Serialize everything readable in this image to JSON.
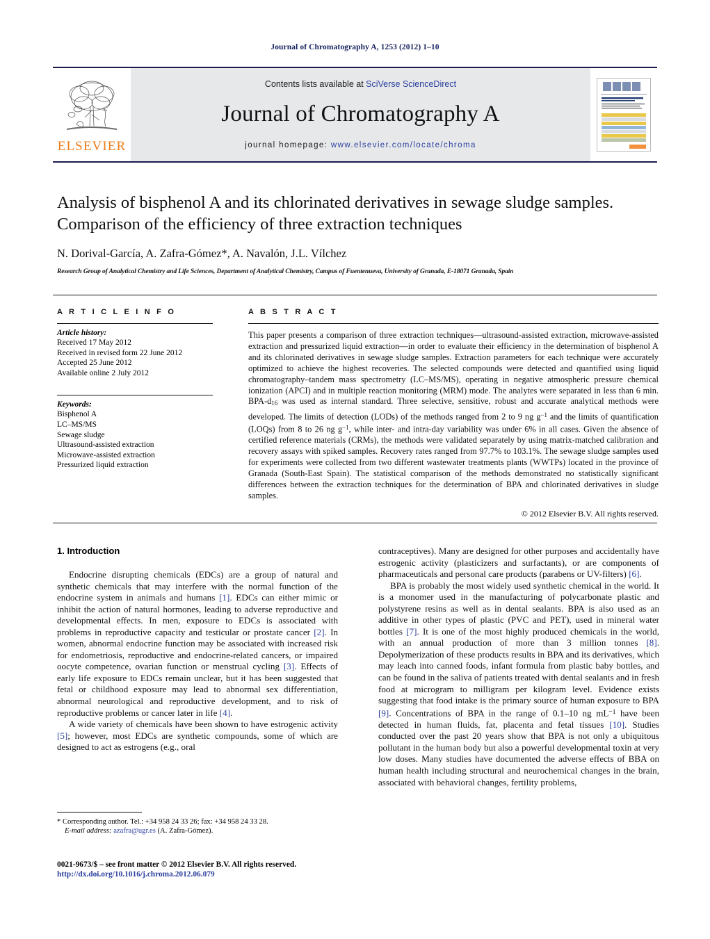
{
  "running_head": "Journal of Chromatography A, 1253 (2012) 1–10",
  "masthead": {
    "contents_prefix": "Contents lists available at ",
    "sciencedirect": "SciVerse ScienceDirect",
    "journal_name": "Journal of Chromatography A",
    "homepage_prefix": "journal homepage: ",
    "homepage_url": "www.elsevier.com/locate/chroma",
    "publisher_logo_text": "ELSEVIER",
    "publisher_logo_icon": "elsevier-tree-icon",
    "cover_thumbnail_icon": "journal-cover-thumbnail",
    "accent_link_color": "#2a3f9d",
    "logo_color": "#f07c1a",
    "rule_color": "#1a1a4e"
  },
  "article": {
    "title": "Analysis of bisphenol A and its chlorinated derivatives in sewage sludge samples. Comparison of the efficiency of three extraction techniques",
    "authors": "N. Dorival-García, A. Zafra-Gómez*, A. Navalón, J.L. Vílchez",
    "affiliation": "Research Group of Analytical Chemistry and Life Sciences, Department of Analytical Chemistry, Campus of Fuentenueva, University of Granada, E-18071 Granada, Spain"
  },
  "article_info": {
    "heading": "A R T I C L E   I N F O",
    "history_label": "Article history:",
    "history": [
      "Received 17 May 2012",
      "Received in revised form 22 June 2012",
      "Accepted 25 June 2012",
      "Available online 2 July 2012"
    ],
    "keywords_label": "Keywords:",
    "keywords": [
      "Bisphenol A",
      "LC–MS/MS",
      "Sewage sludge",
      "Ultrasound-assisted extraction",
      "Microwave-assisted extraction",
      "Pressurized liquid extraction"
    ]
  },
  "abstract": {
    "heading": "A B S T R A C T",
    "part1": "This paper presents a comparison of three extraction techniques—ultrasound-assisted extraction, microwave-assisted extraction and pressurized liquid extraction—in order to evaluate their efficiency in the determination of bisphenol A and its chlorinated derivatives in sewage sludge samples. Extraction parameters for each technique were accurately optimized to achieve the highest recoveries. The selected compounds were detected and quantified using liquid chromatography–tandem mass spectrometry (LC–MS/MS), operating in negative atmospheric pressure chemical ionization (APCI) and in multiple reaction monitoring (MRM) mode. The analytes were separated in less than 6 min. BPA-d",
    "sub1": "16",
    "part2": " was used as internal standard. Three selective, sensitive, robust and accurate analytical methods were developed. The limits of detection (LODs) of the methods ranged from 2 to 9 ng g",
    "sup1": "−1",
    "part3": " and the limits of quantification (LOQs) from 8 to 26 ng g",
    "sup2": "−1",
    "part4": ", while inter- and intra-day variability was under 6% in all cases. Given the absence of certified reference materials (CRMs), the methods were validated separately by using matrix-matched calibration and recovery assays with spiked samples. Recovery rates ranged from 97.7% to 103.1%. The sewage sludge samples used for experiments were collected from two different wastewater treatments plants (WWTPs) located in the province of Granada (South-East Spain). The statistical comparison of the methods demonstrated no statistically significant differences between the extraction techniques for the determination of BPA and chlorinated derivatives in sludge samples.",
    "copyright": "© 2012 Elsevier B.V. All rights reserved."
  },
  "introduction": {
    "heading": "1.  Introduction",
    "left": {
      "p1_a": "Endocrine disrupting chemicals (EDCs) are a group of natural and synthetic chemicals that may interfere with the normal function of the endocrine system in animals and humans ",
      "p1_ref1": "[1]",
      "p1_b": ". EDCs can either mimic or inhibit the action of natural hormones, leading to adverse reproductive and developmental effects. In men, exposure to EDCs is associated with problems in reproductive capacity and testicular or prostate cancer ",
      "p1_ref2": "[2]",
      "p1_c": ". In women, abnormal endocrine function may be associated with increased risk for endometriosis, reproductive and endocrine-related cancers, or impaired oocyte competence, ovarian function or menstrual cycling ",
      "p1_ref3": "[3]",
      "p1_d": ". Effects of early life exposure to EDCs remain unclear, but it has been suggested that fetal or childhood exposure may lead to abnormal sex differentiation, abnormal neurological and reproductive development, and to risk of reproductive problems or cancer later in life ",
      "p1_ref4": "[4]",
      "p1_e": ".",
      "p2_a": "A wide variety of chemicals have been shown to have estrogenic activity ",
      "p2_ref5": "[5]",
      "p2_b": "; however, most EDCs are synthetic compounds, some of which are designed to act as estrogens (e.g., oral"
    },
    "right": {
      "p2_cont_a": "contraceptives). Many are designed for other purposes and accidentally have estrogenic activity (plasticizers and surfactants), or are components of pharmaceuticals and personal care products (parabens or UV-filters) ",
      "p2_cont_ref6": "[6]",
      "p2_cont_b": ".",
      "p3_a": "BPA is probably the most widely used synthetic chemical in the world. It is a monomer used in the manufacturing of polycarbonate plastic and polystyrene resins as well as in dental sealants. BPA is also used as an additive in other types of plastic (PVC and PET), used in mineral water bottles ",
      "p3_ref7": "[7]",
      "p3_b": ". It is one of the most highly produced chemicals in the world, with an annual production of more than 3 million tonnes ",
      "p3_ref8": "[8]",
      "p3_c": ". Depolymerization of these products results in BPA and its derivatives, which may leach into canned foods, infant formula from plastic baby bottles, and can be found in the saliva of patients treated with dental sealants and in fresh food at microgram to milligram per kilogram level. Evidence exists suggesting that food intake is the primary source of human exposure to BPA ",
      "p3_ref9": "[9]",
      "p3_d": ". Concentrations of BPA in the range of 0.1–10 ng mL",
      "p3_sup": "−1",
      "p3_e": " have been detected in human fluids, fat, placenta and fetal tissues ",
      "p3_ref10": "[10]",
      "p3_f": ". Studies conducted over the past 20 years show that BPA is not only a ubiquitous pollutant in the human body but also a powerful developmental toxin at very low doses. Many studies have documented the adverse effects of BBA on human health including structural and neurochemical changes in the brain, associated with behavioral changes, fertility problems,"
    }
  },
  "footnote": {
    "star": "*",
    "corresponding": " Corresponding author. Tel.: +34 958 24 33 26; fax: +34 958 24 33 28.",
    "email_label": "E-mail address:",
    "email": "azafra@ugr.es",
    "email_owner": " (A. Zafra-Gómez)."
  },
  "footer": {
    "line1": "0021-9673/$ – see front matter © 2012 Elsevier B.V. All rights reserved.",
    "line2": "http://dx.doi.org/10.1016/j.chroma.2012.06.079"
  }
}
